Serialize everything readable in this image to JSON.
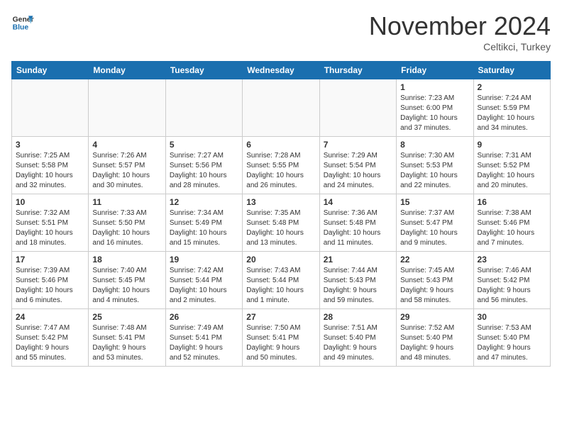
{
  "logo": {
    "line1": "General",
    "line2": "Blue"
  },
  "title": "November 2024",
  "location": "Celtikci, Turkey",
  "weekdays": [
    "Sunday",
    "Monday",
    "Tuesday",
    "Wednesday",
    "Thursday",
    "Friday",
    "Saturday"
  ],
  "weeks": [
    [
      {
        "day": "",
        "info": ""
      },
      {
        "day": "",
        "info": ""
      },
      {
        "day": "",
        "info": ""
      },
      {
        "day": "",
        "info": ""
      },
      {
        "day": "",
        "info": ""
      },
      {
        "day": "1",
        "info": "Sunrise: 7:23 AM\nSunset: 6:00 PM\nDaylight: 10 hours\nand 37 minutes."
      },
      {
        "day": "2",
        "info": "Sunrise: 7:24 AM\nSunset: 5:59 PM\nDaylight: 10 hours\nand 34 minutes."
      }
    ],
    [
      {
        "day": "3",
        "info": "Sunrise: 7:25 AM\nSunset: 5:58 PM\nDaylight: 10 hours\nand 32 minutes."
      },
      {
        "day": "4",
        "info": "Sunrise: 7:26 AM\nSunset: 5:57 PM\nDaylight: 10 hours\nand 30 minutes."
      },
      {
        "day": "5",
        "info": "Sunrise: 7:27 AM\nSunset: 5:56 PM\nDaylight: 10 hours\nand 28 minutes."
      },
      {
        "day": "6",
        "info": "Sunrise: 7:28 AM\nSunset: 5:55 PM\nDaylight: 10 hours\nand 26 minutes."
      },
      {
        "day": "7",
        "info": "Sunrise: 7:29 AM\nSunset: 5:54 PM\nDaylight: 10 hours\nand 24 minutes."
      },
      {
        "day": "8",
        "info": "Sunrise: 7:30 AM\nSunset: 5:53 PM\nDaylight: 10 hours\nand 22 minutes."
      },
      {
        "day": "9",
        "info": "Sunrise: 7:31 AM\nSunset: 5:52 PM\nDaylight: 10 hours\nand 20 minutes."
      }
    ],
    [
      {
        "day": "10",
        "info": "Sunrise: 7:32 AM\nSunset: 5:51 PM\nDaylight: 10 hours\nand 18 minutes."
      },
      {
        "day": "11",
        "info": "Sunrise: 7:33 AM\nSunset: 5:50 PM\nDaylight: 10 hours\nand 16 minutes."
      },
      {
        "day": "12",
        "info": "Sunrise: 7:34 AM\nSunset: 5:49 PM\nDaylight: 10 hours\nand 15 minutes."
      },
      {
        "day": "13",
        "info": "Sunrise: 7:35 AM\nSunset: 5:48 PM\nDaylight: 10 hours\nand 13 minutes."
      },
      {
        "day": "14",
        "info": "Sunrise: 7:36 AM\nSunset: 5:48 PM\nDaylight: 10 hours\nand 11 minutes."
      },
      {
        "day": "15",
        "info": "Sunrise: 7:37 AM\nSunset: 5:47 PM\nDaylight: 10 hours\nand 9 minutes."
      },
      {
        "day": "16",
        "info": "Sunrise: 7:38 AM\nSunset: 5:46 PM\nDaylight: 10 hours\nand 7 minutes."
      }
    ],
    [
      {
        "day": "17",
        "info": "Sunrise: 7:39 AM\nSunset: 5:46 PM\nDaylight: 10 hours\nand 6 minutes."
      },
      {
        "day": "18",
        "info": "Sunrise: 7:40 AM\nSunset: 5:45 PM\nDaylight: 10 hours\nand 4 minutes."
      },
      {
        "day": "19",
        "info": "Sunrise: 7:42 AM\nSunset: 5:44 PM\nDaylight: 10 hours\nand 2 minutes."
      },
      {
        "day": "20",
        "info": "Sunrise: 7:43 AM\nSunset: 5:44 PM\nDaylight: 10 hours\nand 1 minute."
      },
      {
        "day": "21",
        "info": "Sunrise: 7:44 AM\nSunset: 5:43 PM\nDaylight: 9 hours\nand 59 minutes."
      },
      {
        "day": "22",
        "info": "Sunrise: 7:45 AM\nSunset: 5:43 PM\nDaylight: 9 hours\nand 58 minutes."
      },
      {
        "day": "23",
        "info": "Sunrise: 7:46 AM\nSunset: 5:42 PM\nDaylight: 9 hours\nand 56 minutes."
      }
    ],
    [
      {
        "day": "24",
        "info": "Sunrise: 7:47 AM\nSunset: 5:42 PM\nDaylight: 9 hours\nand 55 minutes."
      },
      {
        "day": "25",
        "info": "Sunrise: 7:48 AM\nSunset: 5:41 PM\nDaylight: 9 hours\nand 53 minutes."
      },
      {
        "day": "26",
        "info": "Sunrise: 7:49 AM\nSunset: 5:41 PM\nDaylight: 9 hours\nand 52 minutes."
      },
      {
        "day": "27",
        "info": "Sunrise: 7:50 AM\nSunset: 5:41 PM\nDaylight: 9 hours\nand 50 minutes."
      },
      {
        "day": "28",
        "info": "Sunrise: 7:51 AM\nSunset: 5:40 PM\nDaylight: 9 hours\nand 49 minutes."
      },
      {
        "day": "29",
        "info": "Sunrise: 7:52 AM\nSunset: 5:40 PM\nDaylight: 9 hours\nand 48 minutes."
      },
      {
        "day": "30",
        "info": "Sunrise: 7:53 AM\nSunset: 5:40 PM\nDaylight: 9 hours\nand 47 minutes."
      }
    ]
  ]
}
